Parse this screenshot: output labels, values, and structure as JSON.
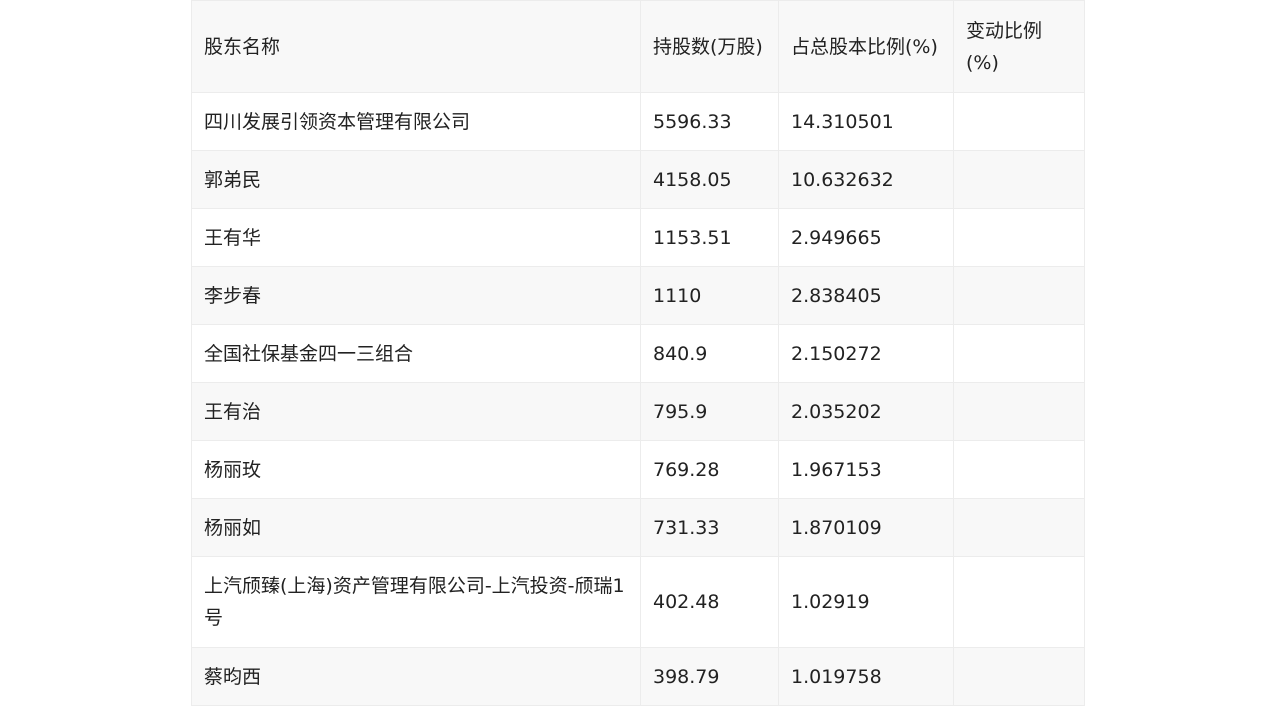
{
  "table": {
    "headers": [
      "股东名称",
      "持股数(万股)",
      "占总股本比例(%)",
      "变动比例(%)"
    ],
    "rows": [
      [
        "四川发展引领资本管理有限公司",
        "5596.33",
        "14.310501",
        ""
      ],
      [
        "郭弟民",
        "4158.05",
        "10.632632",
        ""
      ],
      [
        "王有华",
        "1153.51",
        "2.949665",
        ""
      ],
      [
        "李步春",
        "1110",
        "2.838405",
        ""
      ],
      [
        "全国社保基金四一三组合",
        "840.9",
        "2.150272",
        ""
      ],
      [
        "王有治",
        "795.9",
        "2.035202",
        ""
      ],
      [
        "杨丽玫",
        "769.28",
        "1.967153",
        ""
      ],
      [
        "杨丽如",
        "731.33",
        "1.870109",
        ""
      ],
      [
        "上汽颀臻(上海)资产管理有限公司-上汽投资-颀瑞1号",
        "402.48",
        "1.02919",
        ""
      ],
      [
        "蔡昀西",
        "398.79",
        "1.019758",
        ""
      ]
    ]
  }
}
